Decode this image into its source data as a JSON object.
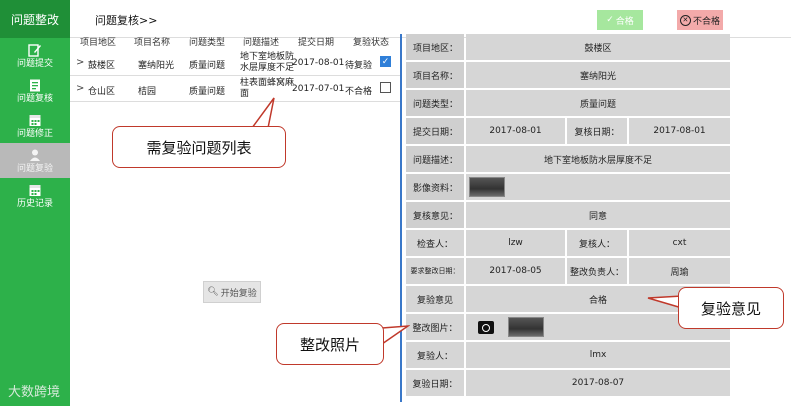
{
  "sidebar": {
    "header": "问题整改",
    "items": [
      {
        "label": "问题提交",
        "icon": "edit-icon",
        "active": false
      },
      {
        "label": "问题复核",
        "icon": "clipboard-icon",
        "active": false
      },
      {
        "label": "问题修正",
        "icon": "calendar-icon",
        "active": false
      },
      {
        "label": "问题复验",
        "icon": "person-icon",
        "active": true
      },
      {
        "label": "历史记录",
        "icon": "calendar-icon",
        "active": false
      }
    ],
    "watermark": "大数跨境"
  },
  "header": {
    "title": "问题复核>>",
    "pass_label": "合格",
    "fail_label": "不合格"
  },
  "list": {
    "columns": [
      "项目地区",
      "项目名称",
      "问题类型",
      "问题描述",
      "提交日期",
      "复验状态"
    ],
    "rows": [
      {
        "area": "鼓楼区",
        "name": "塞纳阳光",
        "type": "质量问题",
        "desc": "地下室地板防水层厚度不足",
        "date": "2017-08-01",
        "status": "待复验",
        "checked": true
      },
      {
        "area": "仓山区",
        "name": "桔园",
        "type": "质量问题",
        "desc": "柱表面蜂窝麻面",
        "date": "2017-07-01",
        "status": "不合格",
        "checked": false
      }
    ],
    "start_button": "开始复验"
  },
  "detail": {
    "area_label": "项目地区：",
    "area": "鼓楼区",
    "name_label": "项目名称：",
    "name": "塞纳阳光",
    "type_label": "问题类型：",
    "type": "质量问题",
    "submit_date_label": "提交日期：",
    "submit_date": "2017-08-01",
    "review_date_label": "复核日期：",
    "review_date": "2017-08-01",
    "desc_label": "问题描述：",
    "desc": "地下室地板防水层厚度不足",
    "media_label": "影像资料：",
    "review_opinion_label": "复核意见：",
    "review_opinion": "同意",
    "inspector_label": "检查人：",
    "inspector": "lzw",
    "reviewer_label": "复核人：",
    "reviewer": "cxt",
    "deadline_label": "要求整改日期：",
    "deadline": "2017-08-05",
    "rectifier_label": "整改负责人：",
    "rectifier": "周瑜",
    "reinspect_opinion_label": "复验意见",
    "reinspect_opinion": "合格",
    "rectify_photo_label": "整改图片：",
    "reinspector_label": "复验人：",
    "reinspector": "lmx",
    "reinspect_date_label": "复验日期：",
    "reinspect_date": "2017-08-07"
  },
  "callouts": {
    "list": "需复验问题列表",
    "opinion": "复验意见",
    "photo": "整改照片"
  },
  "colors": {
    "sidebar": "#2db14a",
    "sidebar_header": "#1f8f37",
    "pass": "#a6e79e",
    "fail": "#f3aaaa",
    "divider": "#3a78c9",
    "cell": "#d6d6d6",
    "callout_border": "#c0392b"
  }
}
